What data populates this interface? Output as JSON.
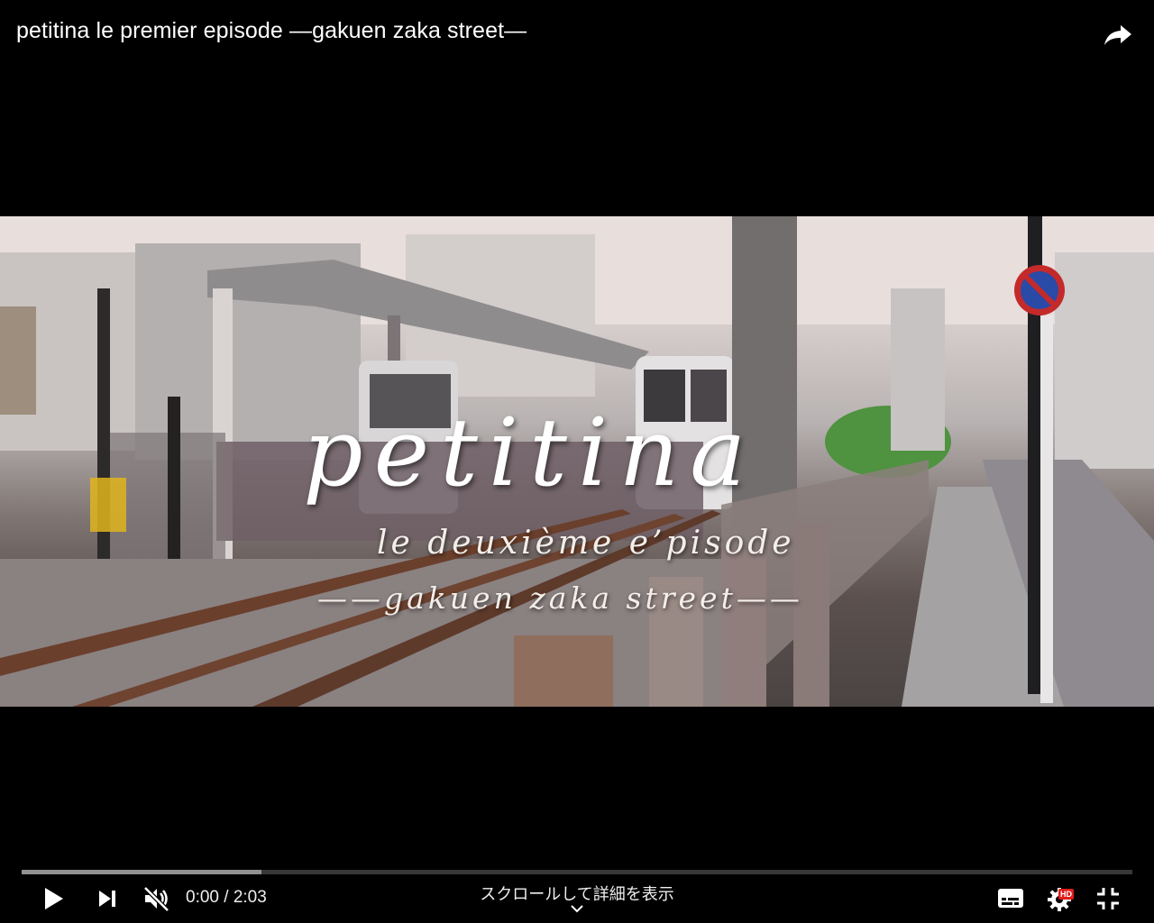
{
  "header": {
    "title": "petitina le premier episode —gakuen zaka street—",
    "share_icon": "share-arrow-icon"
  },
  "video": {
    "overlay_title": "petitina",
    "overlay_subtitle": "le deuxième e’pisode",
    "overlay_tagline": "——gakuen zaka street——"
  },
  "player": {
    "progress_loaded_fraction": 0.216,
    "progress_played_fraction": 0.0,
    "time_display": "0:00 / 2:03",
    "scroll_hint": "スクロールして詳細を表示",
    "hd_badge": "HD",
    "icons": {
      "play": "play-icon",
      "next": "next-icon",
      "mute": "muted-volume-icon",
      "subtitles": "subtitles-icon",
      "settings": "gear-icon",
      "fullscreen_exit": "exit-fullscreen-icon",
      "chevron": "chevron-down-icon"
    },
    "colors": {
      "hd_badge": "#e01b1b",
      "loaded_bar": "#8a8a8a"
    }
  }
}
